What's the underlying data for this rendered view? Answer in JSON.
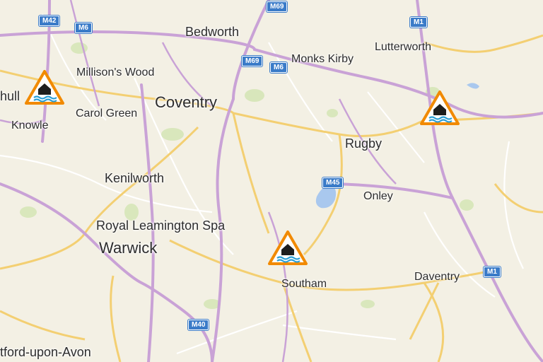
{
  "map": {
    "places": {
      "bedworth": "Bedworth",
      "monks_kirby": "Monks Kirby",
      "lutterworth": "Lutterworth",
      "millisons_wood": "Millison's Wood",
      "solihull_partial": "hull",
      "coventry": "Coventry",
      "carol_green": "Carol Green",
      "knowle": "Knowle",
      "rugby": "Rugby",
      "kenilworth": "Kenilworth",
      "onley": "Onley",
      "royal_leamington_spa": "Royal Leamington Spa",
      "warwick": "Warwick",
      "southam": "Southam",
      "daventry": "Daventry",
      "stratford_partial": "tford-upon-Avon"
    },
    "road_shields": {
      "m42": "M42",
      "m6_west": "M6",
      "m69_north": "M69",
      "m69_coventry": "M69",
      "m6_east": "M6",
      "m1_north": "M1",
      "m45": "M45",
      "m1_south": "M1",
      "m40": "M40"
    },
    "flood_warnings": [
      {
        "id": "knowle"
      },
      {
        "id": "lutterworth"
      },
      {
        "id": "southam"
      }
    ],
    "colors": {
      "land": "#f3f0e4",
      "motorway": "#c9a2d6",
      "a_road": "#f3cf72",
      "minor_road": "#ffffff",
      "water": "#a9c8ee",
      "park": "#d6e5b7",
      "shield": "#3a7bc8",
      "warning_border": "#f18a00"
    }
  }
}
